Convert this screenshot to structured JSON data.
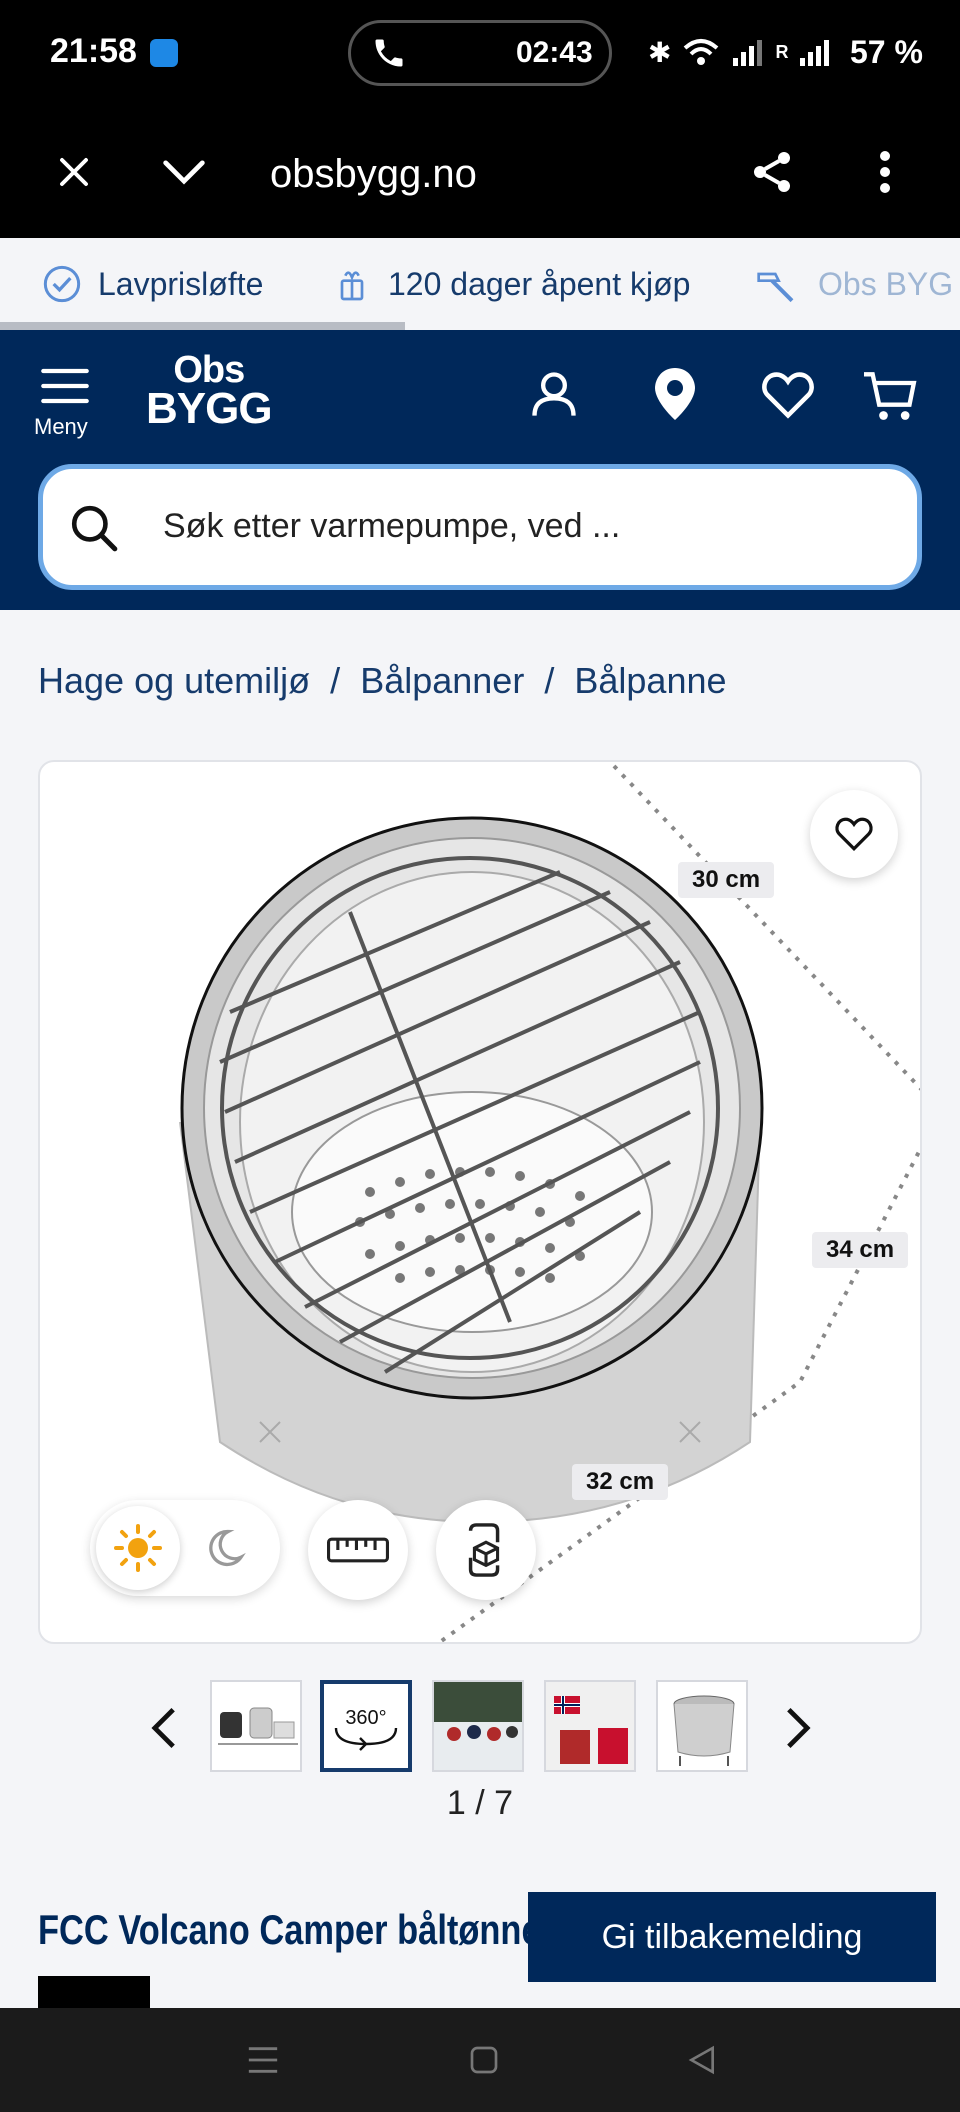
{
  "status_bar": {
    "time": "21:58",
    "call_time": "02:43",
    "battery": "57 %",
    "network_label": "R"
  },
  "browser": {
    "url": "obsbygg.no",
    "close_icon": "close-icon",
    "menu_icon": "more-vert-icon"
  },
  "promo": {
    "items": [
      {
        "label": "Lavprisløfte",
        "icon": "check-circle-icon"
      },
      {
        "label": "120 dager åpent kjøp",
        "icon": "gift-icon"
      },
      {
        "label": "Obs BYG",
        "icon": "hammer-icon"
      }
    ]
  },
  "header": {
    "menu_label": "Meny",
    "logo_line1": "Obs",
    "logo_line2": "BYGG",
    "search_placeholder": "Søk etter varmepumpe, ved ..."
  },
  "breadcrumb": {
    "items": [
      "Hage og utemiljø",
      "Bålpanner",
      "Bålpanne"
    ],
    "separator": "/"
  },
  "gallery": {
    "dimensions": [
      "30 cm",
      "34 cm",
      "32 cm"
    ],
    "pager": "1 / 7"
  },
  "product": {
    "title": "FCC Volcano Camper båltønne"
  },
  "feedback": {
    "label": "Gi tilbakemelding"
  },
  "colors": {
    "brand_navy": "#00285a",
    "link_navy": "#163b6c",
    "search_border": "#6ea9e6",
    "sun_orange": "#f2a20f"
  }
}
